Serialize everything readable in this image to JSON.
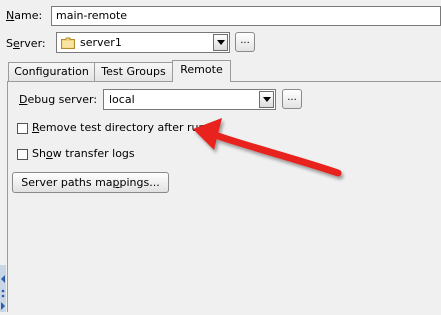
{
  "name": {
    "label": "Name:",
    "value": "main-remote"
  },
  "server": {
    "label": "Server:",
    "selected": "server1",
    "browse_label": "..."
  },
  "tabs": [
    {
      "label": "Configuration"
    },
    {
      "label": "Test Groups"
    },
    {
      "label": "Remote"
    }
  ],
  "remote": {
    "debug_server_label": "Debug server:",
    "debug_server_value": "local",
    "debug_browse_label": "...",
    "remove_dir_label": "Remove test directory after run",
    "show_logs_label": "Show transfer logs",
    "paths_button_label": "Server paths mappings..."
  },
  "annotation": {
    "color": "#e8201c"
  }
}
